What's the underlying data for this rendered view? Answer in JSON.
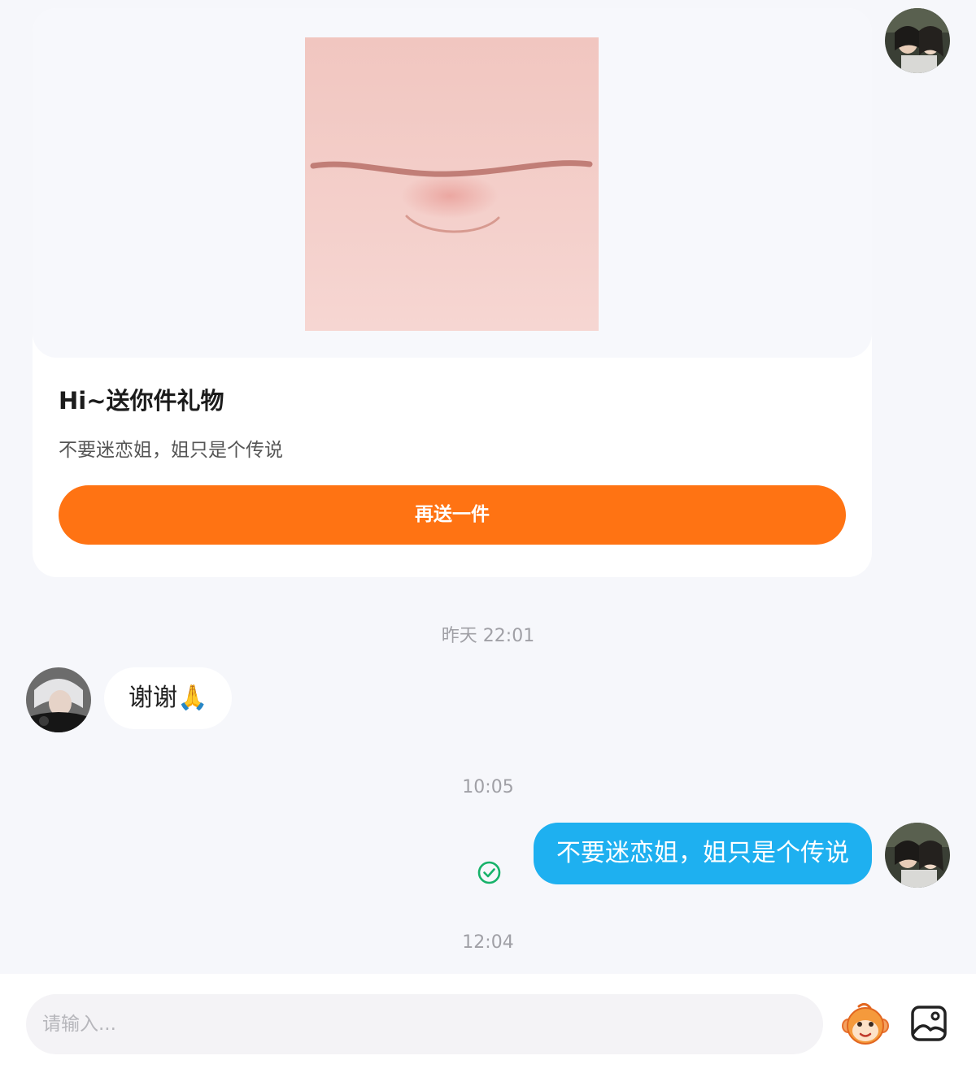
{
  "gift_card": {
    "title": "Hi~送你件礼物",
    "subtitle": "不要迷恋姐，姐只是个传说",
    "button_label": "再送一件",
    "image_subject": "lips-gift-icon"
  },
  "messages": [
    {
      "type": "timestamp",
      "text": "昨天 22:01"
    },
    {
      "type": "incoming",
      "text": "谢谢🙏"
    },
    {
      "type": "timestamp",
      "text": "10:05"
    },
    {
      "type": "outgoing",
      "text": "不要迷恋姐，姐只是个传说",
      "status": "read-check-icon"
    },
    {
      "type": "timestamp",
      "text": "12:04"
    }
  ],
  "input_bar": {
    "placeholder": "请输入...",
    "emoji_icon": "monkey-emoji-icon",
    "image_icon": "image-picker-icon"
  },
  "colors": {
    "page_bg": "#f6f7fb",
    "accent_orange": "#ff7313",
    "outgoing_bubble": "#1eb0f0",
    "read_check": "#17b26a"
  }
}
